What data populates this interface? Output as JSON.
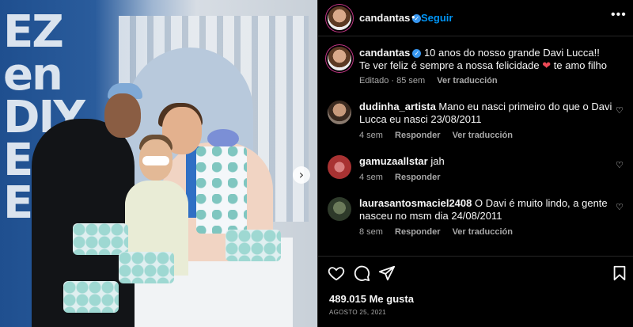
{
  "post": {
    "wall_text": "EZ\nen\nDIY\nE\nE"
  },
  "header": {
    "username": "candantas",
    "separator": "•",
    "follow_label": "Seguir",
    "more_label": "•••"
  },
  "caption": {
    "username": "candantas",
    "text": "10 anos do nosso grande Davi Lucca!! Te ver feliz é sempre a nossa felicidade",
    "text_after": "te amo filho",
    "edited": "Editado · 85 sem",
    "translate": "Ver traducción"
  },
  "comments": [
    {
      "username": "dudinha_artista",
      "text": "Mano eu nasci primeiro do que o Davi Lucca eu nasci 23/08/2011",
      "time": "4 sem",
      "reply": "Responder",
      "translate": "Ver traducción"
    },
    {
      "username": "gamuzaallstar",
      "text": "jah",
      "time": "4 sem",
      "reply": "Responder",
      "translate": ""
    },
    {
      "username": "laurasantosmaciel2408",
      "text": "O Davi é muito lindo, a gente nasceu no msm dia 24/08/2011",
      "time": "8 sem",
      "reply": "Responder",
      "translate": "Ver traducción"
    }
  ],
  "footer": {
    "likes": "489.015 Me gusta",
    "date": "AGOSTO 25, 2021"
  },
  "icons": [
    "heart-icon",
    "comment-icon",
    "share-icon",
    "bookmark-icon",
    "verified-icon",
    "chevron-right-icon"
  ],
  "colors": {
    "accent": "#0095f6",
    "verified": "#3897f0",
    "heart": "#ed4956",
    "muted": "#a8a8a8"
  }
}
